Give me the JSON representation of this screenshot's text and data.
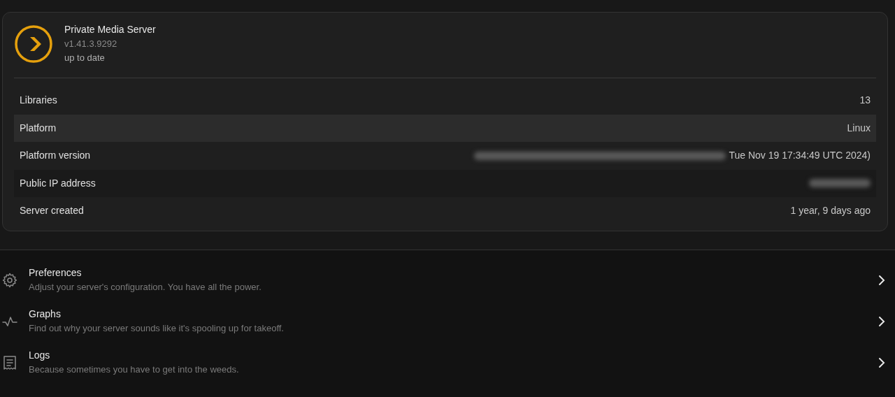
{
  "server": {
    "name": "Private Media Server",
    "version": "v1.41.3.9292",
    "status": "up to date"
  },
  "details": [
    {
      "label": "Libraries",
      "value": "13",
      "highlighted": false,
      "redacted": false
    },
    {
      "label": "Platform",
      "value": "Linux",
      "highlighted": true,
      "redacted": false
    },
    {
      "label": "Platform version",
      "value": "Tue Nov 19 17:34:49 UTC 2024)",
      "highlighted": false,
      "redacted": true
    },
    {
      "label": "Public IP address",
      "highlighted": false,
      "redacted": true
    },
    {
      "label": "Server created",
      "value": "1 year, 9 days ago",
      "highlighted": false,
      "redacted": false
    }
  ],
  "menu": [
    {
      "kind": "gear",
      "title": "Preferences",
      "description": "Adjust your server's configuration. You have all the power."
    },
    {
      "kind": "pulse",
      "title": "Graphs",
      "description": "Find out why your server sounds like it's spooling up for takeoff."
    },
    {
      "kind": "receipt",
      "title": "Logs",
      "description": "Because sometimes you have to get into the weeds."
    }
  ]
}
